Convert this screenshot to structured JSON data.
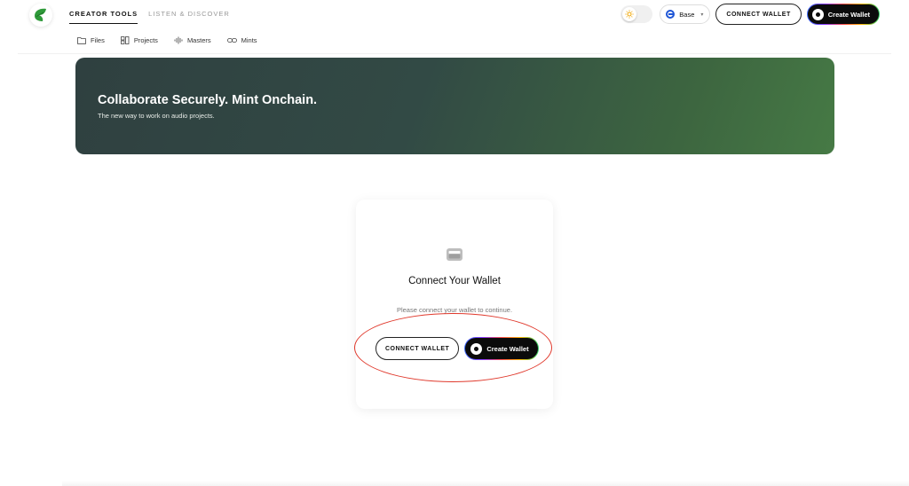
{
  "header": {
    "tabs": [
      {
        "label": "CREATOR TOOLS",
        "active": true
      },
      {
        "label": "LISTEN & DISCOVER",
        "active": false
      }
    ],
    "theme_toggle": {
      "icon": "sun-icon"
    },
    "network": {
      "label": "Base",
      "icon": "base-network-icon"
    },
    "connect_wallet_label": "CONNECT WALLET",
    "create_wallet_label": "Create Wallet"
  },
  "sub_nav": {
    "items": [
      {
        "label": "Files",
        "icon": "folder-icon"
      },
      {
        "label": "Projects",
        "icon": "projects-icon"
      },
      {
        "label": "Masters",
        "icon": "waveform-icon"
      },
      {
        "label": "Mints",
        "icon": "link-icon"
      }
    ]
  },
  "hero": {
    "title": "Collaborate Securely. Mint Onchain.",
    "subtitle": "The new way to work on audio projects."
  },
  "card": {
    "title": "Connect Your Wallet",
    "text": "Please connect your wallet to continue.",
    "connect_wallet_label": "CONNECT WALLET",
    "create_wallet_label": "Create Wallet"
  },
  "colors": {
    "annotation": "#e0392c",
    "hero_start": "#2f4040",
    "hero_end": "#467a45",
    "brand_green": "#3a9b3f"
  }
}
